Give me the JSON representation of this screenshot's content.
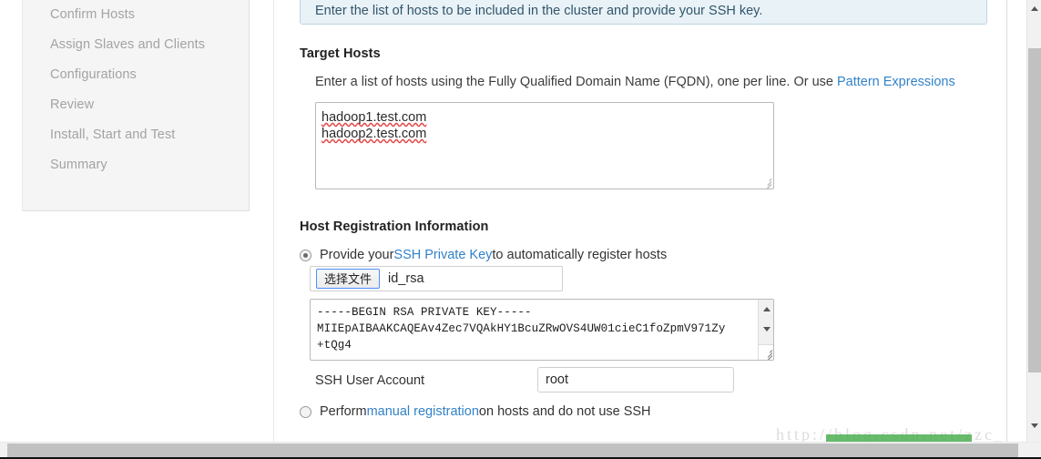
{
  "wizard": {
    "steps": [
      {
        "label": "Confirm Hosts"
      },
      {
        "label": "Assign Slaves and Clients"
      },
      {
        "label": "Configurations"
      },
      {
        "label": "Review"
      },
      {
        "label": "Install, Start and Test"
      },
      {
        "label": "Summary"
      }
    ]
  },
  "banner": {
    "text": "Enter the list of hosts to be included in the cluster and provide your SSH key."
  },
  "target_hosts": {
    "title": "Target Hosts",
    "hint_prefix": "Enter a list of hosts using the Fully Qualified Domain Name (FQDN), one per line. Or use ",
    "hint_link": "Pattern Expressions",
    "hosts": [
      "hadoop1.test.com",
      "hadoop2.test.com"
    ]
  },
  "host_registration": {
    "title": "Host Registration Information",
    "ssh_option": {
      "prefix": "Provide your ",
      "link": "SSH Private Key",
      "suffix": " to automatically register hosts",
      "selected": true
    },
    "file_input": {
      "button_label": "选择文件",
      "file_name": "id_rsa"
    },
    "private_key_value": "-----BEGIN RSA PRIVATE KEY-----\nMIIEpAIBAAKCAQEAv4Zec7VQAkHY1BcuZRwOVS4UW01cieC1foZpmV971Zy\n+tQg4",
    "ssh_user": {
      "label": "SSH User Account",
      "value": "root"
    },
    "manual_option": {
      "prefix": "Perform ",
      "link": "manual registration",
      "suffix": " on hosts and do not use SSH",
      "selected": false
    }
  },
  "watermark": {
    "text": "http://blog.csdn.net/zzc_heu"
  },
  "colors": {
    "link": "#3282c8",
    "banner_bg": "#e9f2f7",
    "banner_border": "#bdd6e2",
    "sidebar_bg": "#f5f5f5",
    "watermark_bar": "#4caf50"
  }
}
